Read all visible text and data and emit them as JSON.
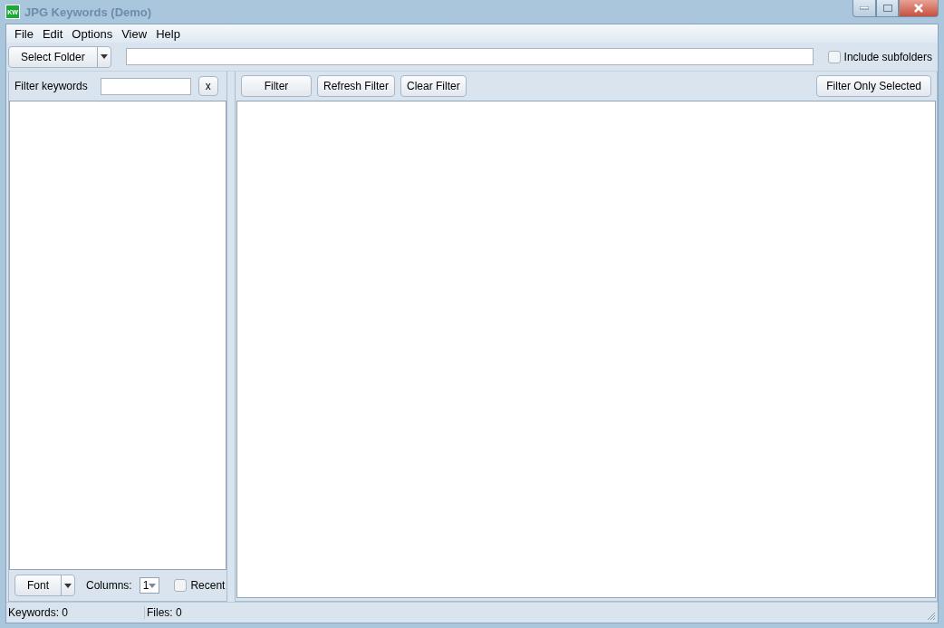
{
  "window": {
    "title": "JPG Keywords (Demo)",
    "app_icon": "KW"
  },
  "menu": [
    "File",
    "Edit",
    "Options",
    "View",
    "Help"
  ],
  "toolbar": {
    "select_folder": "Select Folder",
    "include_subfolders": {
      "label": "Include subfolders",
      "checked": false
    }
  },
  "left_panel": {
    "filter_label": "Filter keywords",
    "clear_button": "x",
    "font_button": "Font",
    "columns_label": "Columns:",
    "columns_value": "1",
    "recent": {
      "label": "Recent",
      "checked": false
    }
  },
  "right_panel": {
    "buttons": [
      "Filter",
      "Refresh Filter",
      "Clear Filter"
    ],
    "filter_only_selected": "Filter Only Selected"
  },
  "status_bar": [
    "Keywords: 0",
    "Files: 0"
  ]
}
